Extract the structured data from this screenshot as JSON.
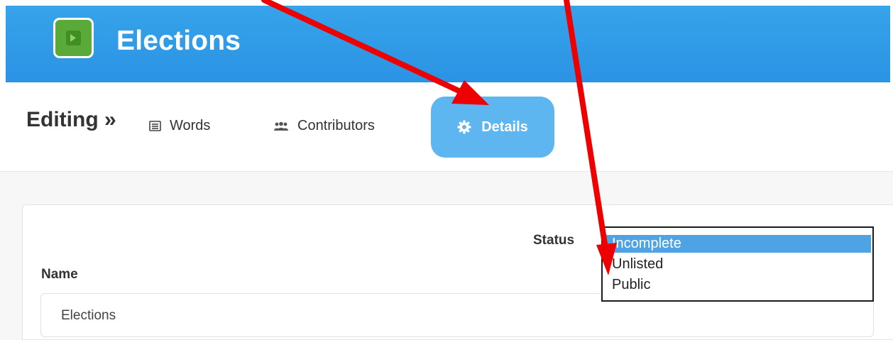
{
  "header": {
    "title": "Elections",
    "logo_icon": "app-logo-icon",
    "background_color": "#2b93e4"
  },
  "editing": {
    "label": "Editing »",
    "tabs": [
      {
        "label": "Words",
        "icon": "list-icon",
        "active": false
      },
      {
        "label": "Contributors",
        "icon": "users-icon",
        "active": false
      },
      {
        "label": "Details",
        "icon": "gear-icon",
        "active": true
      }
    ],
    "active_tab_color": "#5db6f0"
  },
  "form": {
    "status_label": "Status",
    "status_options": [
      "Incomplete",
      "Unlisted",
      "Public"
    ],
    "status_selected": "Incomplete",
    "name_label": "Name",
    "name_value": "Elections"
  },
  "annotation": {
    "arrow_color": "#ee0000",
    "arrow_targets": [
      "Details",
      "Unlisted"
    ]
  }
}
